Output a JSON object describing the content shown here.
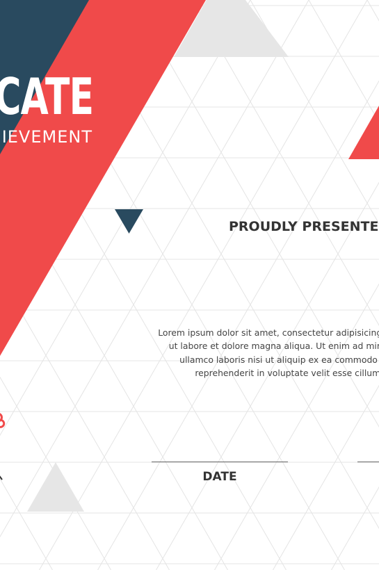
{
  "certificate": {
    "title": "CERTIFICATE",
    "subtitle": "OF ACHIEVEMENT",
    "presented_label": "PROUDLY PRESENTED TO",
    "body_lines": [
      "Lorem ipsum dolor sit amet, consectetur adipisicing elit, sed do eiusmod tempor incididunt",
      "ut labore et dolore magna aliqua. Ut enim ad minim veniam, quis nostrud exercitation",
      "ullamco laboris nisi ut aliquip ex ea commodo consequat. Duis aute irure dolor in",
      "reprehenderit in voluptate velit esse cillum dolore eu fugiat nulla pariatur."
    ],
    "date_label": "DATE"
  },
  "colors": {
    "red": "#f04a4a",
    "navy": "#294a5f",
    "light_gray": "#e6e6e6",
    "grid_line": "#e4e4e4"
  }
}
